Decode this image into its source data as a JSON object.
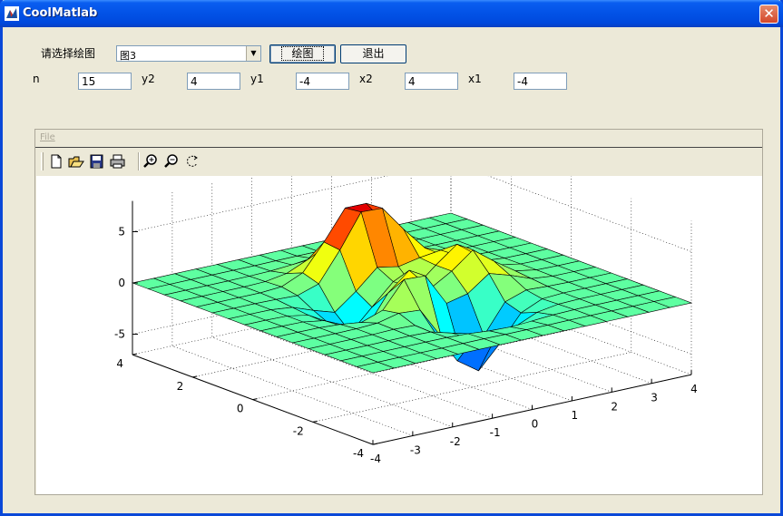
{
  "window": {
    "title": "CoolMatlab"
  },
  "controls": {
    "select_label": "请选择绘图",
    "select_value": "图3",
    "plot_button": "绘图",
    "exit_button": "退出"
  },
  "params": [
    {
      "label": "n",
      "value": "15"
    },
    {
      "label": "y2",
      "value": "4"
    },
    {
      "label": "y1",
      "value": "-4"
    },
    {
      "label": "x2",
      "value": "4"
    },
    {
      "label": "x1",
      "value": "-4"
    }
  ],
  "figure": {
    "menu_file": "File",
    "toolbar": [
      "new-icon",
      "open-icon",
      "save-icon",
      "print-icon",
      "zoom-in-icon",
      "zoom-out-icon",
      "rotate-icon"
    ]
  },
  "chart_data": {
    "type": "surface",
    "title": "",
    "colormap": "jet",
    "zticks": [
      "5",
      "0",
      "-5"
    ],
    "xticks": [
      "-4",
      "-3",
      "-2",
      "-1",
      "0",
      "1",
      "2",
      "3",
      "4"
    ],
    "yticks": [
      "4",
      "2",
      "0",
      "-2",
      "-4"
    ],
    "zlim": [
      -7,
      8
    ],
    "xlim": [
      -4,
      4
    ],
    "ylim": [
      -4,
      4
    ],
    "grid": true,
    "peak_value": 8,
    "trough_value": -6.5
  },
  "colors": {
    "titlebar": "#0252e6",
    "face": "#ece9d8"
  }
}
